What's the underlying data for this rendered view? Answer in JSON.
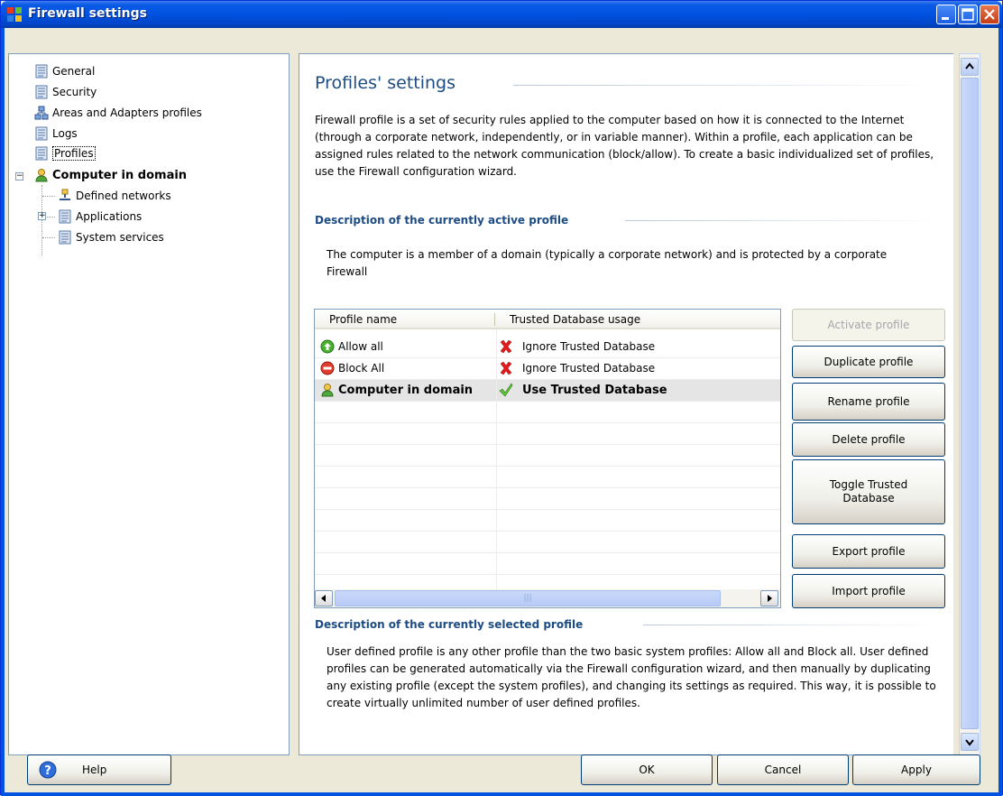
{
  "window": {
    "title": "Firewall settings"
  },
  "tree": {
    "items": [
      {
        "label": "General"
      },
      {
        "label": "Security"
      },
      {
        "label": "Areas and Adapters profiles"
      },
      {
        "label": "Logs"
      },
      {
        "label": "Profiles"
      },
      {
        "label": "Computer in domain"
      },
      {
        "label": "Defined networks"
      },
      {
        "label": "Applications"
      },
      {
        "label": "System services"
      }
    ]
  },
  "content": {
    "title": "Profiles' settings",
    "intro": "Firewall profile is a set of security rules applied to the computer based on how it is connected to the Internet (through a corporate network, independently, or in variable manner). Within a profile, each application can be assigned rules related to the network communication (block/allow). To create a basic individualized set of profiles, use the Firewall configuration wizard.",
    "active_heading": "Description of the currently active profile",
    "active_desc": "The computer is a member of a domain (typically a corporate network) and is protected by a corporate Firewall",
    "selected_heading": "Description of the currently selected profile",
    "selected_desc": "User defined profile is any other profile than the two basic system profiles: Allow all and Block all. User defined profiles can be generated automatically via the Firewall configuration wizard, and then manually by duplicating any existing profile (except the system profiles), and changing its settings as required. This way, it is possible to create virtually unlimited number of user defined profiles."
  },
  "table": {
    "columns": [
      "Profile name",
      "Trusted Database usage"
    ],
    "rows": [
      {
        "name": "Allow all",
        "trusted": "Ignore Trusted Database"
      },
      {
        "name": "Block All",
        "trusted": "Ignore Trusted Database"
      },
      {
        "name": "Computer in domain",
        "trusted": "Use Trusted Database"
      }
    ]
  },
  "side_buttons": {
    "activate": "Activate profile",
    "duplicate": "Duplicate profile",
    "rename": "Rename profile",
    "delete": "Delete profile",
    "toggle": "Toggle Trusted Database",
    "export": "Export profile",
    "import": "Import profile"
  },
  "footer": {
    "help": "Help",
    "ok": "OK",
    "cancel": "Cancel",
    "apply": "Apply"
  }
}
